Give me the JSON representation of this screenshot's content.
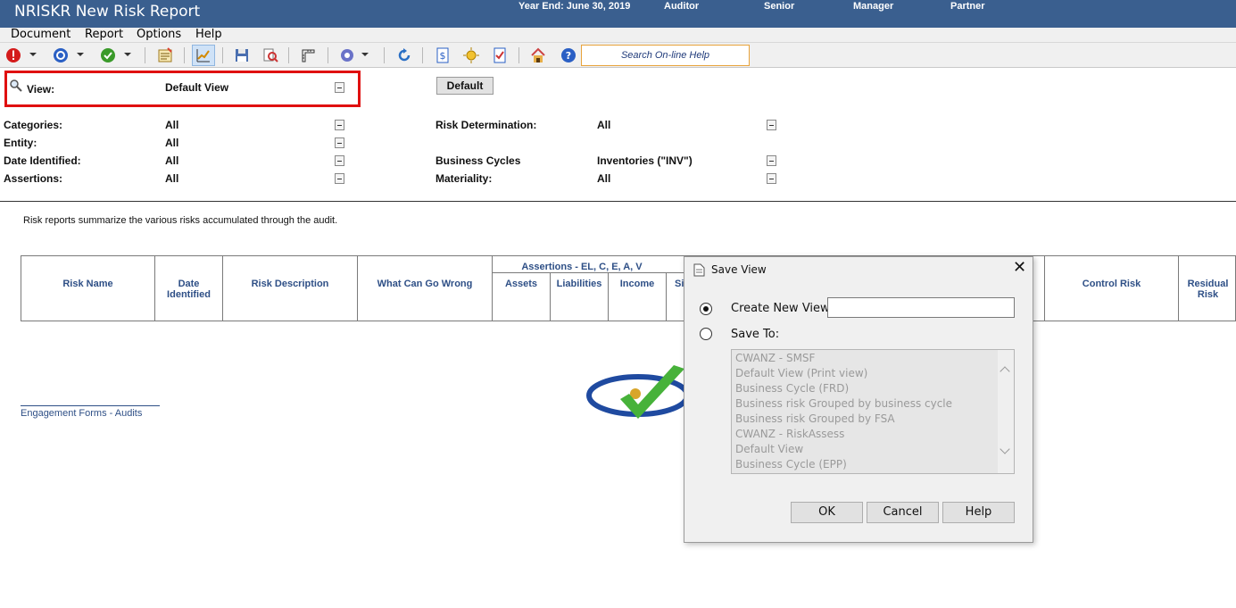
{
  "titlebar": {
    "title": "NRISKR New Risk Report",
    "year_end": "Year End: June 30, 2019",
    "roles": [
      "Auditor",
      "Senior",
      "Manager",
      "Partner"
    ]
  },
  "menu": [
    "Document",
    "Report",
    "Options",
    "Help"
  ],
  "toolbar": {
    "search_help": "Search On-line Help",
    "icons": [
      "stop-icon",
      "info-icon",
      "check-icon",
      "notes-icon",
      "chart-icon",
      "save-icon",
      "search-doc-icon",
      "ruler-icon",
      "gear-icon",
      "refresh-icon",
      "dollar-icon",
      "sun-icon",
      "checklist-icon",
      "home-icon",
      "help-icon"
    ]
  },
  "filters": {
    "view_label": "View:",
    "view_value": "Default View",
    "default_button": "Default",
    "categories_label": "Categories:",
    "categories_value": "All",
    "entity_label": "Entity:",
    "entity_value": "All",
    "date_label": "Date Identified:",
    "date_value": "All",
    "assertions_label": "Assertions:",
    "assertions_value": "All",
    "risk_det_label": "Risk Determination:",
    "risk_det_value": "All",
    "cycles_label": "Business Cycles",
    "cycles_value": "Inventories (\"INV\")",
    "materiality_label": "Materiality:",
    "materiality_value": "All"
  },
  "description": "Risk reports summarize the various risks accumulated through the audit.",
  "table": {
    "assertions_group": "Assertions - EL, C, E, A, V",
    "col_risk_name": "Risk Name",
    "col_date_1": "Date",
    "col_date_2": "Identified",
    "col_risk_desc": "Risk Description",
    "col_what_wrong": "What Can Go Wrong",
    "col_assets": "Assets",
    "col_liabilities": "Liabilities",
    "col_income": "Income",
    "col_partial": "Si",
    "col_control_risk": "Control Risk",
    "col_residual_1": "Residual",
    "col_residual_2": "Risk"
  },
  "footer_link": "Engagement Forms - Audits",
  "dialog": {
    "title": "Save View",
    "create_label": "Create New View:",
    "create_value": "",
    "save_to_label": "Save To:",
    "options": [
      "CWANZ - SMSF",
      "Default View (Print view)",
      "Business Cycle (FRD)",
      "Business risk Grouped by business cycle",
      "Business risk Grouped by FSA",
      "CWANZ - RiskAssess",
      "Default View",
      "Business Cycle (EPP)"
    ],
    "ok": "OK",
    "cancel": "Cancel",
    "help": "Help"
  },
  "colors": {
    "titlebar": "#3a5f8f",
    "highlight_box": "#e01010",
    "header_text": "#2e4f86"
  }
}
